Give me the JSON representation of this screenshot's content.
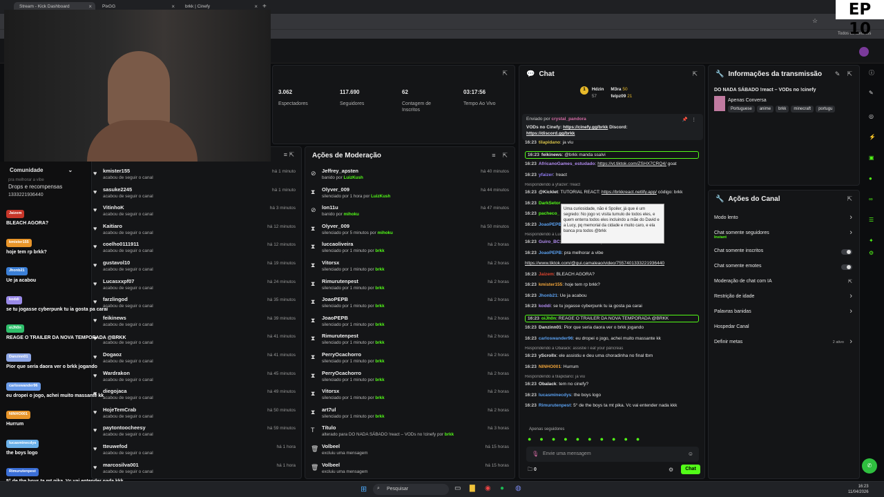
{
  "browser": {
    "tabs": [
      {
        "label": "Stream - Kick Dashboard"
      },
      {
        "label": "PixGG"
      },
      {
        "label": "brkk | Cinefy"
      }
    ],
    "bookmarks_label": "Todos os favoritos",
    "episode": "EP 10"
  },
  "stats": [
    {
      "n": "3.062",
      "l": "Espectadores"
    },
    {
      "n": "117.690",
      "l": "Seguidores"
    },
    {
      "n": "62",
      "l": "Contagem de Inscritos"
    },
    {
      "n": "03:17:56",
      "l": "Tempo Ao Vivo"
    }
  ],
  "followers": [
    {
      "u": "kmister155",
      "s": "acabou de seguir o canal",
      "t": "há 1 minuto"
    },
    {
      "u": "sasuke2245",
      "s": "acabou de seguir o canal",
      "t": "há 1 minuto"
    },
    {
      "u": "VitinhoK",
      "s": "acabou de seguir o canal",
      "t": "há 3 minutos"
    },
    {
      "u": "Kaitiaro",
      "s": "acabou de seguir o canal",
      "t": "há 12 minutos"
    },
    {
      "u": "coelho0111911",
      "s": "acabou de seguir o canal",
      "t": "há 12 minutos"
    },
    {
      "u": "gustavol10",
      "s": "acabou de seguir o canal",
      "t": "há 19 minutos"
    },
    {
      "u": "Lucasxxpf07",
      "s": "acabou de seguir o canal",
      "t": "há 24 minutos"
    },
    {
      "u": "farzlingod",
      "s": "acabou de seguir o canal",
      "t": "há 35 minutos"
    },
    {
      "u": "feikinews",
      "s": "acabou de seguir o canal",
      "t": "há 39 minutos"
    },
    {
      "u": "",
      "s": "acabou de seguir o canal",
      "t": "há 41 minutos"
    },
    {
      "u": "Dogaoz",
      "s": "acabou de seguir o canal",
      "t": "há 41 minutos"
    },
    {
      "u": "Wardrakon",
      "s": "acabou de seguir o canal",
      "t": "há 45 minutos"
    },
    {
      "u": "diegojaca",
      "s": "acabou de seguir o canal",
      "t": "há 49 minutos"
    },
    {
      "u": "HojeTemCrab",
      "s": "acabou de seguir o canal",
      "t": "há 50 minutos"
    },
    {
      "u": "paytontoocheesy",
      "s": "acabou de seguir o canal",
      "t": "há 59 minutos"
    },
    {
      "u": "tteuwefod",
      "s": "acabou de seguir o canal",
      "t": "há 1 hora"
    },
    {
      "u": "marcosilva001",
      "s": "acabou de seguir o canal",
      "t": "há 1 hora"
    }
  ],
  "moderation": {
    "title": "Ações de Moderação",
    "rows": [
      {
        "icon": "ban-icon",
        "g": "⊘",
        "u": "Jeffrey_apsten",
        "s": "banido por ",
        "by": "LuizKush",
        "t": "há 40 minutos"
      },
      {
        "icon": "hourglass-icon",
        "g": "⧗",
        "u": "Olyver_009",
        "s": "silenciado por 1 hora por ",
        "by": "LuizKush",
        "t": "há 44 minutos"
      },
      {
        "icon": "ban-icon",
        "g": "⊘",
        "u": "lon11u",
        "s": "banido por ",
        "by": "mihoku",
        "t": "há 47 minutos"
      },
      {
        "icon": "hourglass-icon",
        "g": "⧗",
        "u": "Olyver_009",
        "s": "silenciado por 5 minutos por ",
        "by": "mihoku",
        "t": "há 50 minutos"
      },
      {
        "icon": "hourglass-icon",
        "g": "⧗",
        "u": "luccaoliveira",
        "s": "silenciado por 1 minuto por ",
        "by": "brkk",
        "t": "há 2 horas"
      },
      {
        "icon": "hourglass-icon",
        "g": "⧗",
        "u": "Vitorsx",
        "s": "silenciado por 1 minuto por ",
        "by": "brkk",
        "t": "há 2 horas"
      },
      {
        "icon": "hourglass-icon",
        "g": "⧗",
        "u": "Rimurutenpest",
        "s": "silenciado por 1 minuto por ",
        "by": "brkk",
        "t": "há 2 horas"
      },
      {
        "icon": "hourglass-icon",
        "g": "⧗",
        "u": "JoaoPEPB",
        "s": "silenciado por 1 minuto por ",
        "by": "brkk",
        "t": "há 2 horas"
      },
      {
        "icon": "hourglass-icon",
        "g": "⧗",
        "u": "JoaoPEPB",
        "s": "silenciado por 1 minuto por ",
        "by": "brkk",
        "t": "há 2 horas"
      },
      {
        "icon": "hourglass-icon",
        "g": "⧗",
        "u": "Rimurutenpest",
        "s": "silenciado por 1 minuto por ",
        "by": "brkk",
        "t": "há 2 horas"
      },
      {
        "icon": "hourglass-icon",
        "g": "⧗",
        "u": "PerryOcachorro",
        "s": "silenciado por 1 minuto por ",
        "by": "brkk",
        "t": "há 2 horas"
      },
      {
        "icon": "hourglass-icon",
        "g": "⧗",
        "u": "PerryOcachorro",
        "s": "silenciado por 1 minuto por ",
        "by": "brkk",
        "t": "há 2 horas"
      },
      {
        "icon": "hourglass-icon",
        "g": "⧗",
        "u": "Vitorsx",
        "s": "silenciado por 1 minuto por ",
        "by": "brkk",
        "t": "há 2 horas"
      },
      {
        "icon": "hourglass-icon",
        "g": "⧗",
        "u": "art7ul",
        "s": "silenciado por 1 minuto por ",
        "by": "brkk",
        "t": "há 2 horas"
      },
      {
        "icon": "text-icon",
        "g": "T",
        "u": "Título",
        "s": "alterado para DO NADA SÁBADO !react – VODs no !cinefy por ",
        "by": "brkk",
        "t": "há 3 horas"
      },
      {
        "icon": "trash-icon",
        "g": "🗑",
        "u": "Volbeel",
        "s": "excluiu uma mensagem",
        "by": "",
        "t": "há 15 horas"
      },
      {
        "icon": "trash-icon",
        "g": "🗑",
        "u": "Volbeel",
        "s": "excluiu uma mensagem",
        "by": "",
        "t": "há 15 horas"
      }
    ]
  },
  "chat": {
    "title": "Chat",
    "top": [
      {
        "name": "Hdzin",
        "val": "57"
      },
      {
        "name": "M3ra",
        "val": "50"
      },
      {
        "name": "felpz09",
        "val": "21"
      }
    ],
    "pinned": {
      "by": "Enviado por",
      "user": "crystal_pandora",
      "text": "VODs no Cinefy: ",
      "link1": "https://cinefy.gg/brkk",
      "mid": " Discord: ",
      "link2": "https://discord.gg/brkk"
    },
    "tooltip": "Uma curiosidade, não é Spoiler, já que é um segredo: No jogo vc visita tumulo de todos eles, e quem enterra todos eles incluindo a mãe do David e a Lucy, pq memorial da cidade e muito caro, e ela banca pra todos @brkk",
    "messages": [
      {
        "ts": "16:23",
        "name": "tilapidano",
        "color": "#d9c44a",
        "text": ": ja viu",
        "link": "",
        "hl": false,
        "rep": ""
      },
      {
        "ts": "16:23",
        "name": "feikinews",
        "color": "#e8e8e8",
        "text": ": @brkk manda ssalvi",
        "link": "",
        "hl": true,
        "rep": ""
      },
      {
        "ts": "16:23",
        "name": "AfricanoGames_estudado",
        "color": "#b28cf0",
        "text": ": ",
        "link": "https://vt.tiktok.com/ZSHX7CRQ4/",
        "after": " goat",
        "hl": false,
        "rep": ""
      },
      {
        "ts": "16:23",
        "name": "yfaizer",
        "color": "#8f7bf0",
        "text": ": !react",
        "link": "",
        "hl": false,
        "rep": ""
      },
      {
        "ts": "",
        "name": "",
        "color": "",
        "text": "",
        "link": "",
        "hl": false,
        "rep": "Respondendo a yfaizer: !react"
      },
      {
        "ts": "16:23",
        "name": "@Kicklet",
        "color": "#e8e8e8",
        "text": ": TUTORIAL REACT: ",
        "link": "https://brkkreact.netlify.app/",
        "after": " código: brkk",
        "hl": false,
        "rep": ""
      },
      {
        "ts": "16:23",
        "name": "DarkSetor",
        "color": "#53fc18",
        "text": "",
        "link": "",
        "hl": false,
        "rep": ""
      },
      {
        "ts": "16:23",
        "name": "pacheco_",
        "color": "#53fc18",
        "text": "",
        "link": "",
        "hl": false,
        "rep": ""
      },
      {
        "ts": "16:23",
        "name": "JoaoPEPB",
        "color": "#5aa0f0",
        "text": "",
        "link": "https://www.tiktok.com/...",
        "hl": false,
        "rep": ""
      },
      {
        "ts": "",
        "name": "",
        "color": "",
        "text": "",
        "link": "",
        "hl": false,
        "rep": "Respondendo a LuizKush: Uma curiosidade, não é Spoiler, já que é um..."
      },
      {
        "ts": "16:23",
        "name": "Guiro_BC",
        "color": "#b28cf0",
        "text": ": nem sabia dessa, q foda",
        "link": "",
        "hl": false,
        "rep": ""
      },
      {
        "ts": "16:23",
        "name": "JoaoPEPB",
        "color": "#5aa0f0",
        "text": ": pra melhorar a vibe",
        "link": "",
        "hl": false,
        "rep": ""
      },
      {
        "ts": "",
        "name": "",
        "color": "",
        "text": "",
        "link": "https://www.tiktok.com/@gui.camaleao/video/7557401333221936440",
        "hl": false,
        "rep": ""
      },
      {
        "ts": "16:23",
        "name": "Jaizem",
        "color": "#e0452f",
        "text": ": BLEACH AGORA?",
        "link": "",
        "hl": false,
        "rep": ""
      },
      {
        "ts": "16:23",
        "name": "kmister155",
        "color": "#f0a43a",
        "text": ": hoje tem rp brkk?",
        "link": "",
        "hl": false,
        "rep": ""
      },
      {
        "ts": "16:23",
        "name": "Jhonb21",
        "color": "#5aa0f0",
        "text": ": Ue ja acabou",
        "link": "",
        "hl": false,
        "rep": ""
      },
      {
        "ts": "16:23",
        "name": "koddi",
        "color": "#b28cf0",
        "text": ": se tu jogasse cyberpunk tu ia gosta pa carai",
        "link": "",
        "hl": false,
        "rep": ""
      },
      {
        "ts": "16:23",
        "name": "oiJh0n",
        "color": "#53fc18",
        "text": ": REAGE O TRAILER DA NOVA TEMPORADA @BRKK",
        "link": "",
        "hl": true,
        "rep": ""
      },
      {
        "ts": "16:23",
        "name": "Danzinn01",
        "color": "#e8e8e8",
        "text": ": Pior que seria daora ver o brkk jogando",
        "link": "",
        "hl": false,
        "rep": ""
      },
      {
        "ts": "16:23",
        "name": "carloswander96",
        "color": "#5aa0f0",
        "text": ": eu dropei o jogo, achei muito massante kk",
        "link": "",
        "hl": false,
        "rep": ""
      },
      {
        "ts": "",
        "name": "",
        "color": "",
        "text": "",
        "link": "",
        "hl": false,
        "rep": "Respondendo a Obalack: assistie I eat your pâncreas"
      },
      {
        "ts": "16:23",
        "name": "yScrollx",
        "color": "#e8e8e8",
        "text": ": ele assistiu e deu uma choradinha no final tbm",
        "link": "",
        "hl": false,
        "rep": ""
      },
      {
        "ts": "16:23",
        "name": "NINHO001",
        "color": "#f0a43a",
        "text": ": Hurrum",
        "link": "",
        "hl": false,
        "rep": ""
      },
      {
        "ts": "",
        "name": "",
        "color": "",
        "text": "",
        "link": "",
        "hl": false,
        "rep": "Respondendo a tilapidano: ja viu"
      },
      {
        "ts": "16:23",
        "name": "Obalack",
        "color": "#e8e8e8",
        "text": ": tem no cinefy?",
        "link": "",
        "hl": false,
        "rep": ""
      },
      {
        "ts": "16:23",
        "name": "lucasminecdys",
        "color": "#5aa0f0",
        "text": ": the boys logo",
        "link": "",
        "hl": false,
        "rep": ""
      },
      {
        "ts": "16:23",
        "name": "Rimurutenpest",
        "color": "#5aa0f0",
        "text": ": 5° de the boys ta mt pika. Vc vai entender nada kkk",
        "link": "",
        "hl": false,
        "rep": ""
      }
    ],
    "followers_only": "Apenas seguidores",
    "input_placeholder": "Envie uma mensagem",
    "count": "0",
    "send": "Chat"
  },
  "info": {
    "title": "Informações da transmissão",
    "stream_title": "DO NADA SÁBADO !react – VODs no !cinefy",
    "category": "Apenas Conversa",
    "tags": [
      "Portuguese",
      "anime",
      "brkk",
      "minecraft",
      "portugu"
    ]
  },
  "channel": {
    "title": "Ações do Canal",
    "items": [
      {
        "label": "Modo lento",
        "kind": "arrow",
        "sub": ""
      },
      {
        "label": "Chat somente seguidores",
        "kind": "arrow",
        "sub": "Instant"
      },
      {
        "label": "Chat somente inscritos",
        "kind": "toggle",
        "sub": ""
      },
      {
        "label": "Chat somente emotes",
        "kind": "toggle",
        "sub": ""
      },
      {
        "label": "Moderação de chat com IA",
        "kind": "link",
        "sub": ""
      },
      {
        "label": "Restrição de idade",
        "kind": "arrow",
        "sub": ""
      },
      {
        "label": "Palavras banidas",
        "kind": "arrow",
        "sub": ""
      },
      {
        "label": "Hospedar Canal",
        "kind": "none",
        "sub": ""
      },
      {
        "label": "Definir metas",
        "kind": "arrow",
        "sub": "2 ativo"
      }
    ]
  },
  "overlay": {
    "community": "Comunidade",
    "drops": "Drops e recompensas",
    "stream_text": "pra melhorar a vibe",
    "number": "1333221936440",
    "msgs": [
      {
        "badge": "Jaizem",
        "color": "#c7362a",
        "text": "BLEACH AGORA?"
      },
      {
        "badge": "kmister155",
        "color": "#e8952a",
        "text": "hoje tem rp brkk?"
      },
      {
        "badge": "Jhonb21",
        "color": "#3b7fd6",
        "text": "Ue ja acabou"
      },
      {
        "badge": "koddi",
        "color": "#9a8ae8",
        "text": "se tu jogasse cyberpunk tu ia gosta pa carai"
      },
      {
        "badge": "oiJh0n",
        "color": "#2fbf6b",
        "text": "REAGE O TRAILER DA NOVA TEMPORADA @BRKK"
      },
      {
        "badge": "Danzinn01",
        "color": "#8fa8e8",
        "text": "Pior que seria daora ver o brkk jogando"
      },
      {
        "badge": "carloswander96",
        "color": "#6a9be8",
        "text": "eu dropei o jogo, achei muito massante kk"
      },
      {
        "badge": "NINHO001",
        "color": "#e8952a",
        "text": "Hurrum"
      },
      {
        "badge": "lucasminecdys",
        "color": "#6ab0e8",
        "text": "the boys logo"
      },
      {
        "badge": "Rimurutenpest",
        "color": "#3b6fd6",
        "text": "5° de the boys ta mt pika. Vc vai entender nada kkk"
      }
    ]
  },
  "taskbar": {
    "search": "Pesquisar",
    "time": "16:23",
    "date": "11/04/2026"
  },
  "colors": {
    "accent": "#53fc18",
    "bg": "#0c0d0f",
    "panel": "#141517"
  }
}
